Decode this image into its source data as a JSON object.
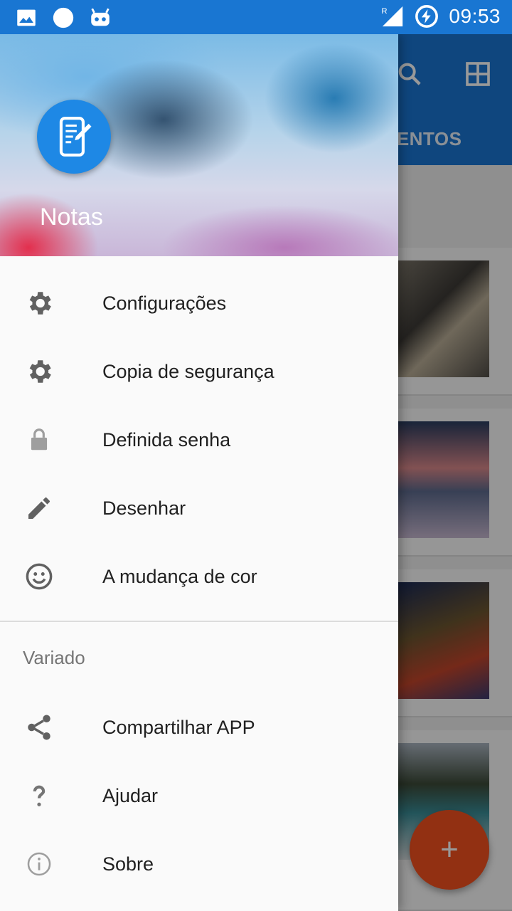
{
  "status_bar": {
    "time": "09:53",
    "icons": [
      "image-icon",
      "circle-icon",
      "android-debug-icon",
      "signal-roaming-icon",
      "battery-charging-icon"
    ],
    "roaming_indicator": "R"
  },
  "background_app": {
    "tab_label": "VENTOS",
    "toolbar_icons": [
      "search-icon",
      "grid-view-icon"
    ],
    "fab_label": "+"
  },
  "drawer": {
    "header": {
      "title": "Notas",
      "logo_icon": "note-edit-icon"
    },
    "items": [
      {
        "label": "Configurações",
        "icon": "gear-icon"
      },
      {
        "label": "Copia de segurança",
        "icon": "gear-icon"
      },
      {
        "label": "Definida senha",
        "icon": "lock-icon"
      },
      {
        "label": "Desenhar",
        "icon": "pencil-icon"
      },
      {
        "label": "A mudança de cor",
        "icon": "smiley-icon"
      }
    ],
    "section_title": "Variado",
    "secondary_items": [
      {
        "label": "Compartilhar APP",
        "icon": "share-icon"
      },
      {
        "label": "Ajudar",
        "icon": "question-icon"
      },
      {
        "label": "Sobre",
        "icon": "info-icon"
      }
    ]
  },
  "colors": {
    "primary": "#1976d2",
    "accent": "#f4511e",
    "drawer_bg": "#fafafa",
    "icon_grey": "#616161"
  }
}
